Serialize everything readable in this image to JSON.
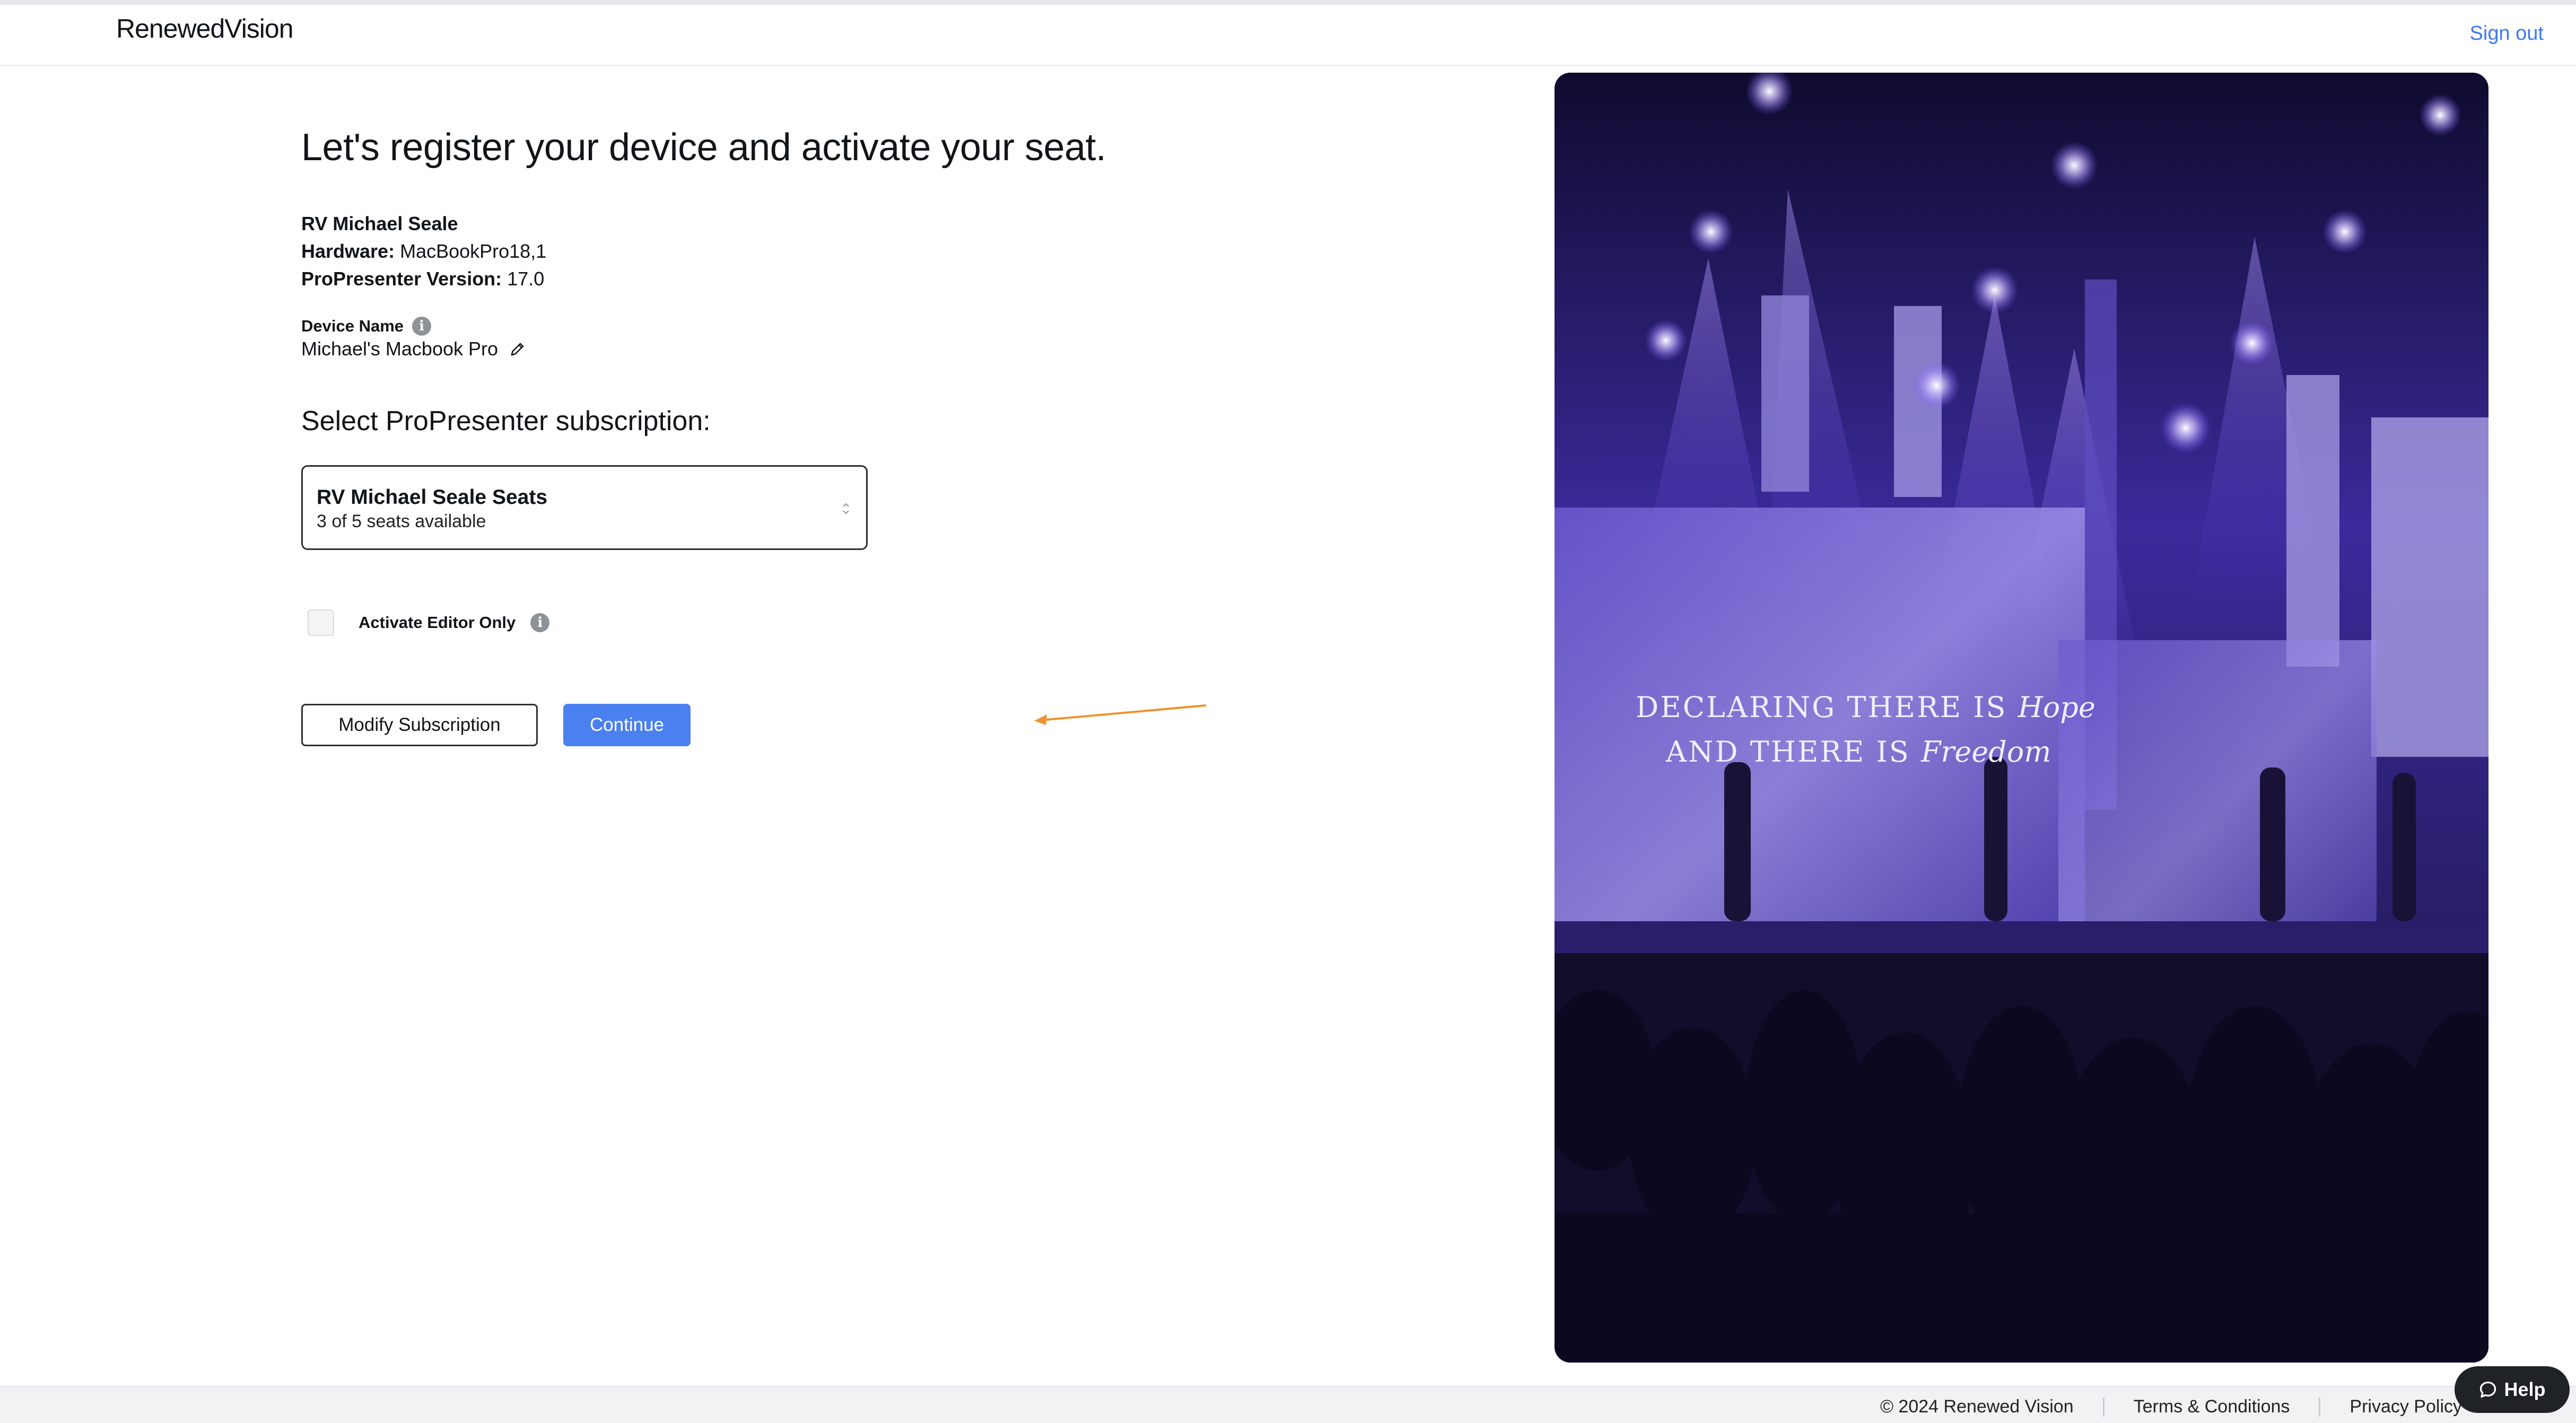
{
  "header": {
    "logo": "RenewedVision",
    "sign_out": "Sign out"
  },
  "main": {
    "title": "Let's register your device and activate your seat.",
    "account_name": "RV Michael Seale",
    "hardware_label": "Hardware:",
    "hardware_value": "MacBookPro18,1",
    "version_label": "ProPresenter Version:",
    "version_value": "17.0",
    "device_name_label": "Device Name",
    "device_name_value": "Michael's Macbook Pro",
    "subscription_heading": "Select ProPresenter subscription:",
    "subscription_select": {
      "selected_title": "RV Michael Seale Seats",
      "selected_subtitle": "3 of 5 seats available"
    },
    "activate_editor_only": {
      "label": "Activate Editor Only",
      "checked": false
    },
    "modify_button": "Modify Subscription",
    "continue_button": "Continue",
    "annotation_arrow_color": "#f0912e"
  },
  "hero_image": {
    "description_icon": "concert-stage-photo",
    "slogan_line1_prefix": "DECLARING THERE IS",
    "slogan_line1_script": "Hope",
    "slogan_line2_prefix": "AND THERE IS",
    "slogan_line2_script": "Freedom"
  },
  "footer": {
    "copyright": "© 2024 Renewed Vision",
    "terms": "Terms & Conditions",
    "privacy": "Privacy Policy"
  },
  "help_button": {
    "label": "Help",
    "icon": "chat-bubble-icon"
  },
  "colors": {
    "accent": "#4a80ef",
    "link": "#3e78f2",
    "text": "#111418",
    "help_bg": "#1f2226"
  }
}
